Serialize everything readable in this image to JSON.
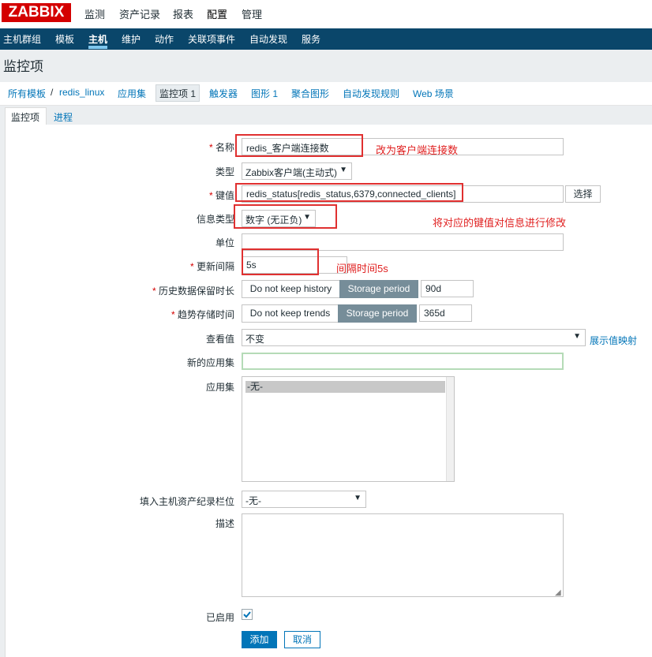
{
  "logo": "ZABBIX",
  "top_menu": [
    "监测",
    "资产记录",
    "报表",
    "配置",
    "管理"
  ],
  "sub_menu": [
    "主机群组",
    "模板",
    "主机",
    "维护",
    "动作",
    "关联项事件",
    "自动发现",
    "服务"
  ],
  "page_title": "监控项",
  "breadcrumb": {
    "all_templates": "所有模板",
    "sep": "/",
    "host": "redis_linux",
    "apps": "应用集",
    "items": "监控项 1",
    "triggers": "触发器",
    "graphs": "图形 1",
    "screens": "聚合图形",
    "discovery": "自动发现规则",
    "web": "Web 场景"
  },
  "tabs": [
    "监控项",
    "进程"
  ],
  "form": {
    "name": {
      "label": "名称",
      "value": "redis_客户端连接数"
    },
    "type": {
      "label": "类型",
      "value": "Zabbix客户端(主动式)"
    },
    "key": {
      "label": "键值",
      "value": "redis_status[redis_status,6379,connected_clients]",
      "select_btn": "选择"
    },
    "info_type": {
      "label": "信息类型",
      "value": "数字 (无正负)"
    },
    "units": {
      "label": "单位",
      "value": ""
    },
    "interval": {
      "label": "更新间隔",
      "value": "5s"
    },
    "history": {
      "label": "历史数据保留时长",
      "off": "Do not keep history",
      "on": "Storage period",
      "value": "90d"
    },
    "trends": {
      "label": "趋势存储时间",
      "off": "Do not keep trends",
      "on": "Storage period",
      "value": "365d"
    },
    "valuemap": {
      "label": "查看值",
      "value": "不变",
      "link": "展示值映射"
    },
    "new_app": {
      "label": "新的应用集",
      "value": ""
    },
    "apps": {
      "label": "应用集",
      "options": [
        "-无-"
      ]
    },
    "inventory": {
      "label": "填入主机资产纪录栏位",
      "value": "-无-"
    },
    "description": {
      "label": "描述",
      "value": ""
    },
    "enabled": {
      "label": "已启用"
    },
    "add_btn": "添加",
    "cancel_btn": "取消",
    "required_mark": "*"
  },
  "annotations": {
    "name_note": "改为客户端连接数",
    "key_note": "将对应的键值对信息进行修改",
    "interval_note": "间隔时间5s"
  }
}
